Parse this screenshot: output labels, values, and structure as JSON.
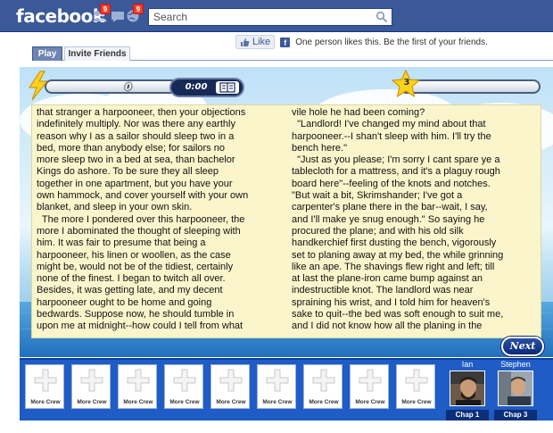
{
  "fbbar": {
    "logo": "facebook",
    "friend_requests_count": "9",
    "notifications_count": "9",
    "search_placeholder": "Search"
  },
  "like": {
    "button_label": "Like",
    "text": "One person likes this. Be the first of your friends."
  },
  "tabs": [
    {
      "label": "Play",
      "active": true
    },
    {
      "label": "Invite Friends",
      "active": false
    }
  ],
  "game": {
    "score": "0",
    "timer": "0:00",
    "stars": "3",
    "next_label": "Next",
    "left_column": "that stranger a harpooneer, then your objections\nindefinitely multiply. Nor was there any earthly\nreason why I as a sailor should sleep two in a\nbed, more than anybody else; for sailors no\nmore sleep two in a bed at sea, than bachelor\nKings do ashore. To be sure they all sleep\ntogether in one apartment, but you have your\nown hammock, and cover yourself with your own\nblanket, and sleep in your own skin.\n  The more I pondered over this harpooneer, the\nmore I abominated the thought of sleeping with\nhim. It was fair to presume that being a\nharpooneer, his linen or woollen, as the case\nmight be, would not be of the tidiest, certainly\nnone of the finest. I began to twitch all over.\nBesides, it was getting late, and my decent\nharpooneer ought to be home and going\nbedwards. Suppose now, he should tumble in\nupon me at midnight--how could I tell from what",
    "right_column": "vile hole he had been coming?\n  \"Landlord! I've changed my mind about that\nharpooneer.--I shan't sleep with him. I'll try the\nbench here.\"\n  \"Just as you please; I'm sorry I cant spare ye a\ntablecloth for a mattress, and it's a plaguy rough\nboard here\"--feeling of the knots and notches.\n\"But wait a bit, Skrimshander; I've got a\ncarpenter's plane there in the bar--wait, I say,\nand I'll make ye snug enough.\" So saying he\nprocured the plane; and with his old silk\nhandkerchief first dusting the bench, vigorously\nset to planing away at my bed, the while grinning\nlike an ape. The shavings flew right and left; till\nat last the plane-iron came bump against an\nindestructible knot. The landlord was near\nspraining his wrist, and I told him for heaven's\nsake to quit--the bed was soft enough to suit me,\nand I did not know how all the planing in the"
  },
  "crew": {
    "slot_label": "More Crew",
    "slots": [
      "More Crew",
      "More Crew",
      "More Crew",
      "More Crew",
      "More Crew",
      "More Crew",
      "More Crew",
      "More Crew",
      "More Crew"
    ],
    "friends": [
      {
        "name": "Ian",
        "chapter": "Chap 1"
      },
      {
        "name": "Stephen",
        "chapter": "Chap 3"
      }
    ]
  },
  "colors": {
    "fb_blue": "#3b5998",
    "crew_bar": "#1f5cc6",
    "text_panel": "#fbf5cc"
  }
}
